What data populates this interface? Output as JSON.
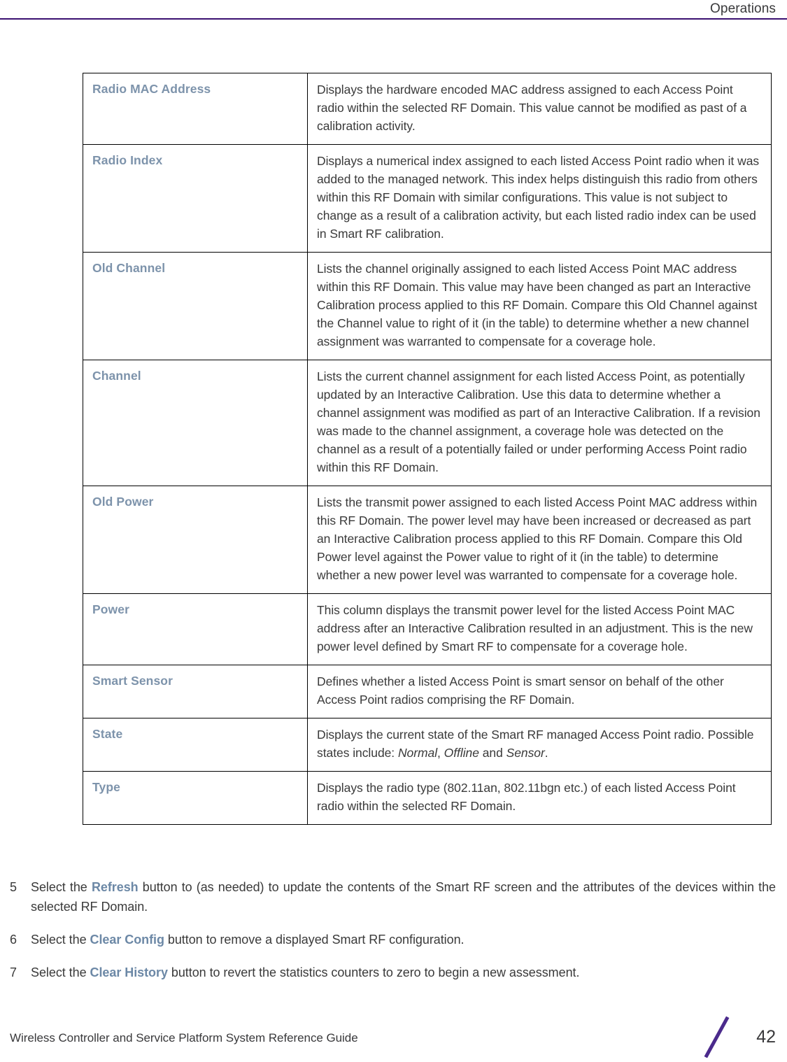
{
  "header": {
    "title": "Operations",
    "rule_color": "#3b1171"
  },
  "table": {
    "term_color": "#7d93ab",
    "rows": [
      {
        "term": "Radio MAC Address",
        "desc_parts": [
          {
            "text": "Displays the hardware encoded MAC address assigned to each Access Point radio within the selected RF Domain. This value cannot be modified as past of a calibration activity.",
            "style": "normal"
          }
        ]
      },
      {
        "term": "Radio Index",
        "desc_parts": [
          {
            "text": "Displays a numerical index assigned to each listed Access Point radio when it was added to the managed network. This index helps distinguish this radio from others within this RF Domain with similar configurations. This value is not subject to change as a result of a calibration activity, but each listed radio index can be used in Smart RF calibration.",
            "style": "normal"
          }
        ]
      },
      {
        "term": "Old Channel",
        "desc_parts": [
          {
            "text": "Lists the channel originally assigned to each listed Access Point MAC address within this RF Domain. This value may have been changed as part an Interactive Calibration process applied to this RF Domain. Compare this Old Channel against the Channel value to right of it (in the table) to determine whether a new channel assignment was warranted to compensate for a coverage hole.",
            "style": "normal"
          }
        ]
      },
      {
        "term": "Channel",
        "desc_parts": [
          {
            "text": "Lists the current channel assignment for each listed Access Point, as potentially updated by an Interactive Calibration. Use this data to determine whether a channel assignment was modified as part of an Interactive Calibration. If a revision was made to the channel assignment, a coverage hole was detected on the channel as a result of a potentially failed or under performing Access Point radio within this RF Domain.",
            "style": "normal"
          }
        ]
      },
      {
        "term": "Old Power",
        "desc_parts": [
          {
            "text": "Lists the transmit power assigned to each listed Access Point MAC address within this RF Domain. The power level may have been increased or decreased as part an Interactive Calibration process applied to this RF Domain. Compare this Old Power level against the Power value to right of it (in the table) to determine whether a new power level was warranted to compensate for a coverage hole.",
            "style": "normal"
          }
        ]
      },
      {
        "term": "Power",
        "desc_parts": [
          {
            "text": "This column displays the transmit power level for the listed Access Point MAC address after an Interactive Calibration resulted in an adjustment. This is the new power level defined by Smart RF to compensate for a coverage hole.",
            "style": "normal"
          }
        ]
      },
      {
        "term": "Smart Sensor",
        "desc_parts": [
          {
            "text": "Defines whether a listed Access Point is smart sensor on behalf of the other Access Point radios comprising the RF Domain.",
            "style": "normal"
          }
        ]
      },
      {
        "term": "State",
        "desc_parts": [
          {
            "text": "Displays the current state of the Smart RF managed Access Point radio. Possible states include: ",
            "style": "normal"
          },
          {
            "text": "Normal",
            "style": "italic"
          },
          {
            "text": ", ",
            "style": "normal"
          },
          {
            "text": "Offline",
            "style": "italic"
          },
          {
            "text": " and ",
            "style": "normal"
          },
          {
            "text": "Sensor",
            "style": "italic"
          },
          {
            "text": ".",
            "style": "normal"
          }
        ]
      },
      {
        "term": "Type",
        "desc_parts": [
          {
            "text": "Displays the radio type (802.11an, 802.11bgn etc.) of each listed Access Point radio within the selected RF Domain.",
            "style": "normal"
          }
        ]
      }
    ]
  },
  "procedure": {
    "link_color": "#6c88a6",
    "items": [
      {
        "number": "5",
        "parts": [
          {
            "text": "Select the ",
            "style": "normal"
          },
          {
            "text": "Refresh",
            "style": "bold"
          },
          {
            "text": " button to (as needed) to update the contents of the Smart RF screen and the attributes of the devices within the selected RF Domain.",
            "style": "normal"
          }
        ]
      },
      {
        "number": "6",
        "parts": [
          {
            "text": "Select the ",
            "style": "normal"
          },
          {
            "text": "Clear Config",
            "style": "bold"
          },
          {
            "text": " button to remove a displayed Smart RF configuration.",
            "style": "normal"
          }
        ]
      },
      {
        "number": "7",
        "parts": [
          {
            "text": "Select the ",
            "style": "normal"
          },
          {
            "text": "Clear History",
            "style": "bold"
          },
          {
            "text": " button to revert the statistics counters to zero to begin a new assessment.",
            "style": "normal"
          }
        ]
      }
    ]
  },
  "footer": {
    "guide_title": "Wireless Controller and Service Platform System Reference Guide",
    "page_number": "42",
    "slash_color": "#4b2a8c"
  }
}
